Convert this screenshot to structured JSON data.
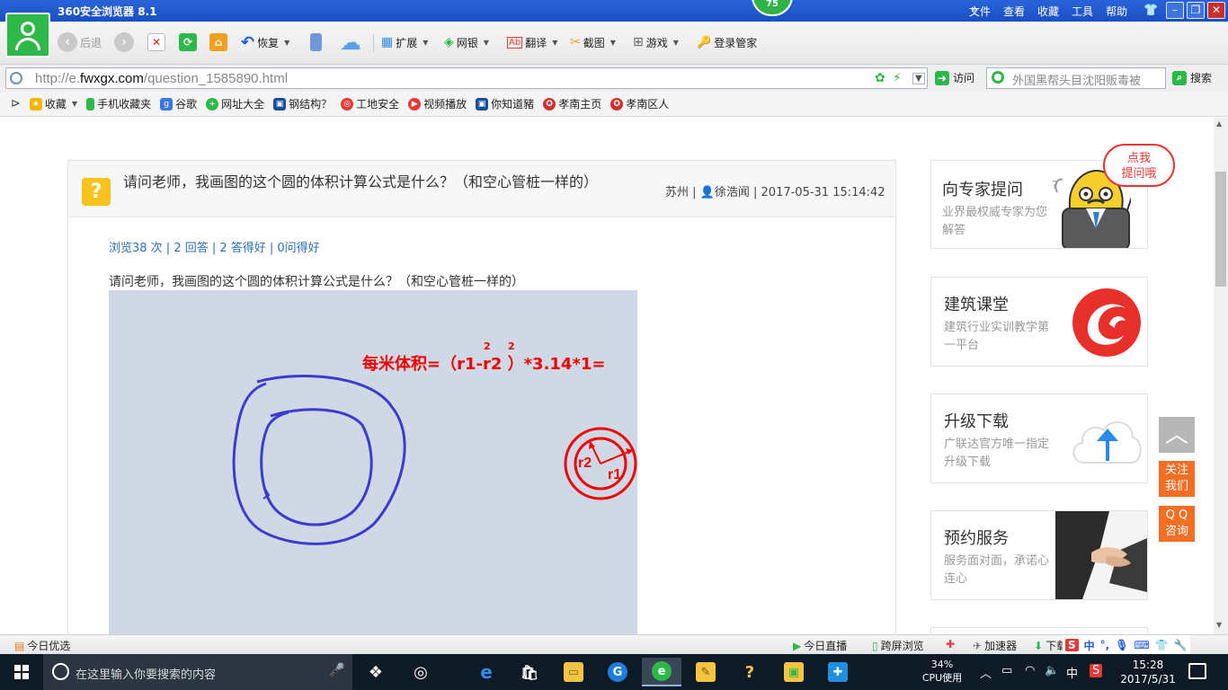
{
  "window": {
    "title": "360安全浏览器 8.1",
    "badge": "75",
    "menus": [
      "文件",
      "查看",
      "收藏",
      "工具",
      "帮助"
    ]
  },
  "toolbar": {
    "back": "后退",
    "restore": "恢复",
    "extend": "扩展",
    "bank": "网银",
    "translate": "翻译",
    "screenshot": "截图",
    "games": "游戏",
    "login_manager": "登录管家"
  },
  "address": {
    "url_prefix": "http://e.",
    "url_domain": "fwxgx.com",
    "url_path": "/question_1585890.html",
    "visit": "访问",
    "search_placeholder": "外国黑帮头目沈阳贩毒被",
    "search_button": "搜索"
  },
  "bookmarks": [
    {
      "label": "收藏",
      "icon": "star-icon",
      "color": "#f5b400"
    },
    {
      "label": "手机收藏夹",
      "icon": "phone-icon",
      "color": "#2eb84a"
    },
    {
      "label": "谷歌",
      "icon": "google-icon",
      "color": "#3b78e7"
    },
    {
      "label": "网址大全",
      "icon": "plus-globe-icon",
      "color": "#2eb84a"
    },
    {
      "label": "钢结构？",
      "icon": "site-icon",
      "color": "#1b4f9c"
    },
    {
      "label": "工地安全",
      "icon": "safety-icon",
      "color": "#e53935"
    },
    {
      "label": "视频播放",
      "icon": "video-icon",
      "color": "#e53935"
    },
    {
      "label": "你知道豬",
      "icon": "site-icon",
      "color": "#1b4f9c"
    },
    {
      "label": "孝南主页",
      "icon": "emblem-icon",
      "color": "#d32f2f"
    },
    {
      "label": "孝南区人",
      "icon": "emblem-icon",
      "color": "#d32f2f"
    }
  ],
  "question": {
    "title": "请问老师，我画图的这个圆的体积计算公式是什么？（和空心管桩一样的）",
    "location": "苏州",
    "user": "徐浩闻",
    "datetime": "2017-05-31 15:14:42",
    "stats": "浏览38 次 | 2 回答 | 2 答得好 | 0问得好",
    "body": "请问老师，我画图的这个圆的体积计算公式是什么？（和空心管桩一样的）",
    "formula_main": "每米体积=（r1",
    "formula_minus": "-r2",
    "formula_tail": " ）*3.14*1=",
    "formula_sup": "2",
    "label_r1": "r1",
    "label_r2": "r2"
  },
  "sidebar": [
    {
      "title": "向专家提问",
      "desc": "业界最权威专家为您解答"
    },
    {
      "title": "建筑课堂",
      "desc": "建筑行业实训教学第一平台"
    },
    {
      "title": "升级下载",
      "desc": "广联达官方唯一指定升级下载"
    },
    {
      "title": "预约服务",
      "desc": "服务面对面，承诺心连心"
    }
  ],
  "bubble": {
    "line1": "点我",
    "line2": "提问哦"
  },
  "float": {
    "follow_1": "关注",
    "follow_2": "我们",
    "qq_1": "Q Q",
    "qq_2": "咨询"
  },
  "statusbar": {
    "left": "今日优选",
    "live": "今日直播",
    "cross_screen": "跨屏浏览",
    "accelerator": "加速器",
    "download": "下载"
  },
  "taskbar": {
    "search_placeholder": "在这里输入你要搜索的内容",
    "cpu_percent": "34%",
    "cpu_label": "CPU使用",
    "ime": "中",
    "time": "15:28",
    "date": "2017/5/31"
  },
  "colors": {
    "accent_green": "#2eb84a",
    "title_blue": "#2a63d9",
    "formula_red": "#ee0000",
    "circle_blue": "#3b3bd0",
    "float_orange": "#f26e25"
  }
}
